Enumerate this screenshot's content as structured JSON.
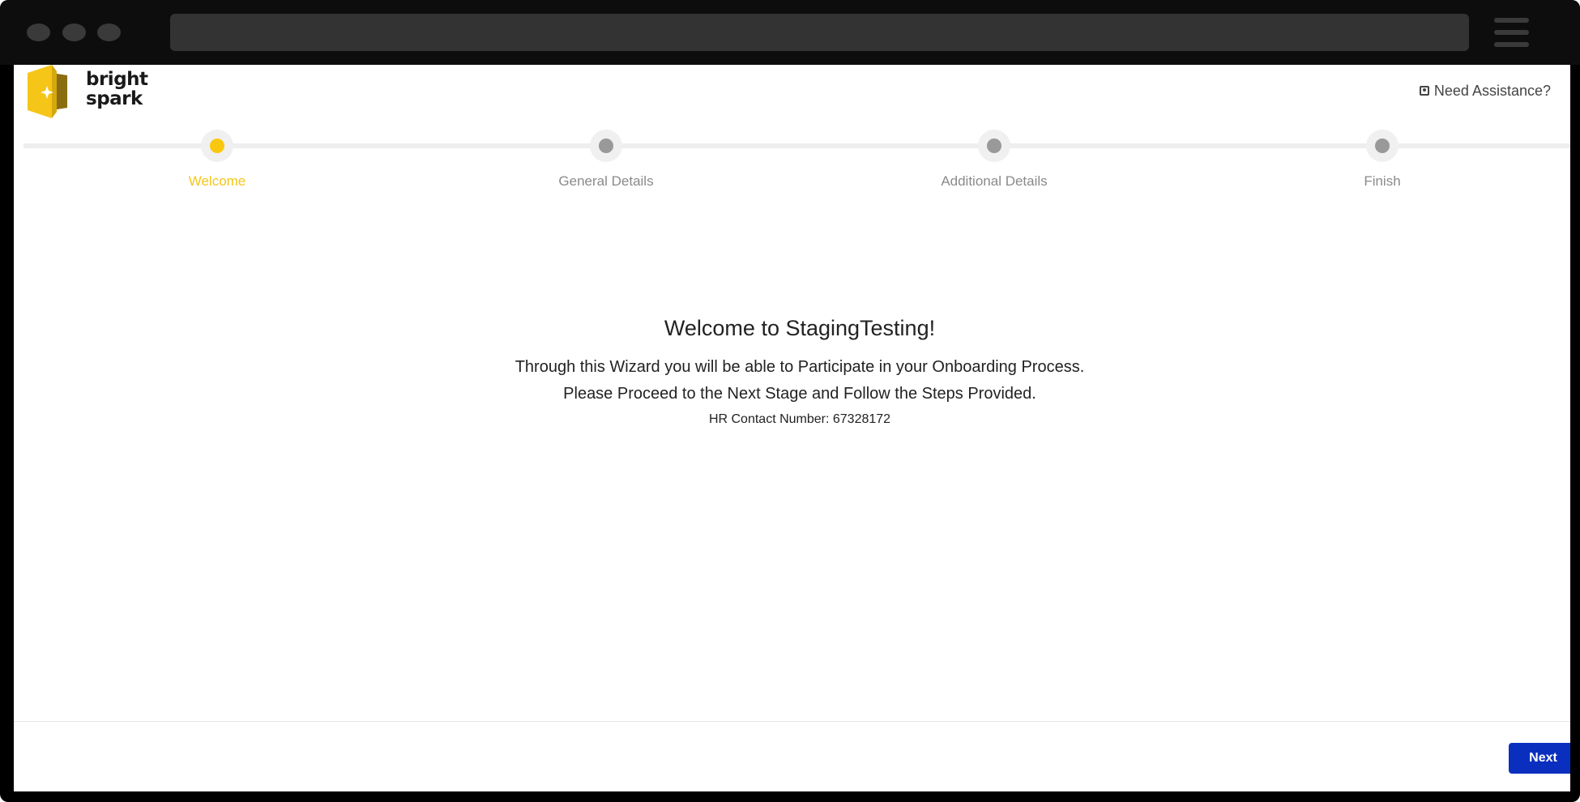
{
  "browser": {
    "window_controls": [
      "close",
      "minimize",
      "maximize"
    ],
    "menu_icon": "hamburger-icon"
  },
  "header": {
    "logo_line1": "bright",
    "logo_line2": "spark",
    "assistance_label": "Need Assistance?",
    "assistance_icon": "contact-card-icon"
  },
  "stepper": {
    "active_color": "#f9c80e",
    "inactive_color": "#999999",
    "steps": [
      {
        "label": "Welcome",
        "active": true
      },
      {
        "label": "General Details",
        "active": false
      },
      {
        "label": "Additional Details",
        "active": false
      },
      {
        "label": "Finish",
        "active": false
      }
    ]
  },
  "main": {
    "title": "Welcome to StagingTesting!",
    "line1": "Through this Wizard you will be able to Participate in your Onboarding Process.",
    "line2": "Please Proceed to the Next Stage and Follow the Steps Provided.",
    "hr_contact": "HR Contact Number: 67328172"
  },
  "footer": {
    "next_label": "Next",
    "next_color": "#0a2fbf"
  }
}
